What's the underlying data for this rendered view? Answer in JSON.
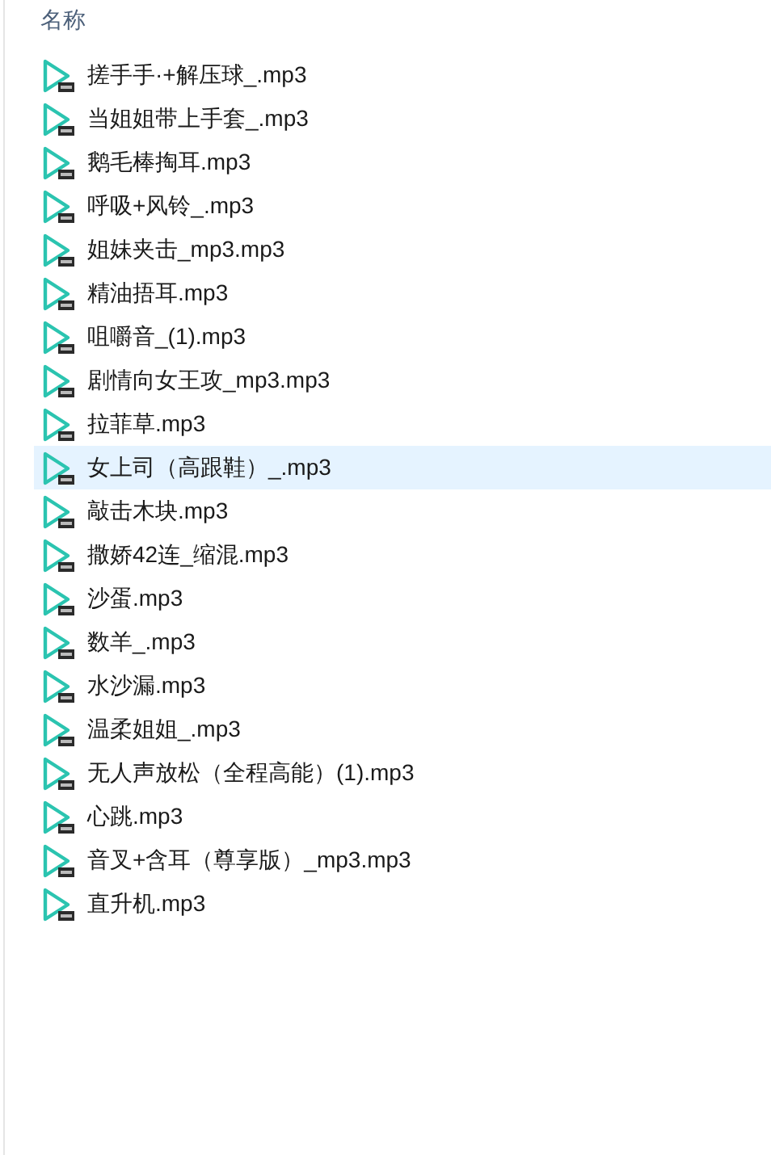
{
  "header": {
    "label": "名称"
  },
  "files": [
    {
      "name": "搓手手·+解压球_.mp3",
      "selected": false
    },
    {
      "name": "当姐姐带上手套_.mp3",
      "selected": false
    },
    {
      "name": "鹅毛棒掏耳.mp3",
      "selected": false
    },
    {
      "name": "呼吸+风铃_.mp3",
      "selected": false
    },
    {
      "name": "姐妹夹击_mp3.mp3",
      "selected": false
    },
    {
      "name": "精油捂耳.mp3",
      "selected": false
    },
    {
      "name": "咀嚼音_(1).mp3",
      "selected": false
    },
    {
      "name": "剧情向女王攻_mp3.mp3",
      "selected": false
    },
    {
      "name": "拉菲草.mp3",
      "selected": false
    },
    {
      "name": "女上司（高跟鞋）_.mp3",
      "selected": true
    },
    {
      "name": "敲击木块.mp3",
      "selected": false
    },
    {
      "name": "撒娇42连_缩混.mp3",
      "selected": false
    },
    {
      "name": "沙蛋.mp3",
      "selected": false
    },
    {
      "name": "数羊_.mp3",
      "selected": false
    },
    {
      "name": "水沙漏.mp3",
      "selected": false
    },
    {
      "name": "温柔姐姐_.mp3",
      "selected": false
    },
    {
      "name": "无人声放松（全程高能）(1).mp3",
      "selected": false
    },
    {
      "name": "心跳.mp3",
      "selected": false
    },
    {
      "name": "音叉+含耳（尊享版）_mp3.mp3",
      "selected": false
    },
    {
      "name": "直升机.mp3",
      "selected": false
    }
  ]
}
